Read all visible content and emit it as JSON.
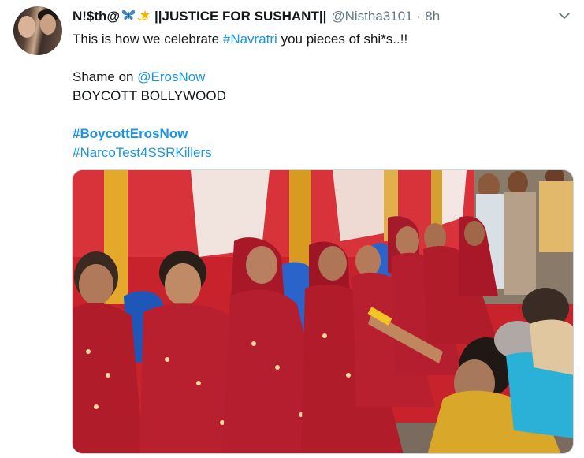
{
  "tweet": {
    "display_name": "N!$th@",
    "display_name_suffix": "||JUSTICE FOR SUSHANT||",
    "handle": "@Nistha3101",
    "separator": "·",
    "time": "8h",
    "emoji": [
      "butterfly-emoji",
      "dizzy-star-emoji"
    ],
    "body": {
      "line1_text": "This is how we celebrate ",
      "line1_hashtag": "#Navratri",
      "line1_rest": " you pieces of shi*s..!!",
      "line2_text": "Shame on ",
      "line2_mention": "@ErosNow",
      "line3": "BOYCOTT BOLLYWOOD",
      "hashtag_bold": "#BoycottErosNow",
      "hashtag_last": "#NarcoTest4SSRKillers"
    },
    "media": {
      "type": "photo"
    }
  },
  "colors": {
    "link": "#1b95e0",
    "secondary_text": "#657786",
    "primary_text": "#14171a",
    "border": "#ccd6dd"
  }
}
